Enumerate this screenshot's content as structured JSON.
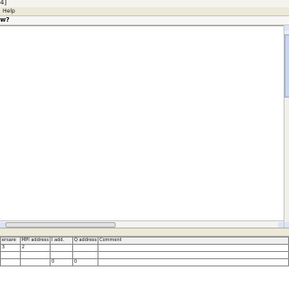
{
  "window": {
    "title": "4]"
  },
  "menubar": {
    "items": [
      {
        "label": "Help"
      }
    ]
  },
  "toolbar": {
    "prompt": "w?"
  },
  "symbol_table": {
    "columns": [
      "ersare",
      "MPI address",
      "I add.",
      "Q address",
      "Comment"
    ],
    "rows": [
      [
        "3",
        "2",
        "",
        "",
        ""
      ],
      [
        "",
        "",
        "",
        "",
        ""
      ],
      [
        "",
        "",
        "0",
        "0",
        ""
      ]
    ]
  }
}
